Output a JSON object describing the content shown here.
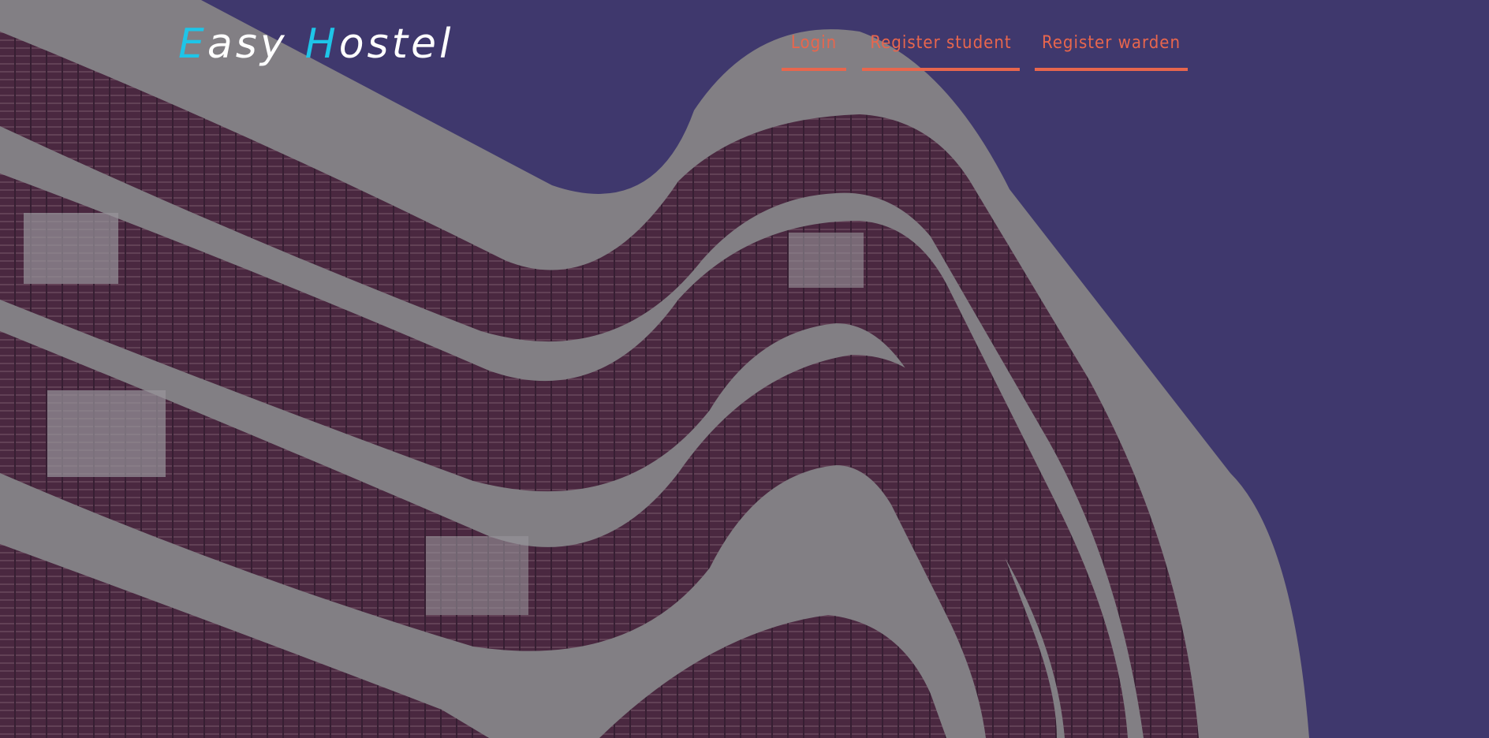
{
  "brand": {
    "initial_1": "E",
    "rest_1": "asy",
    "initial_2": "H",
    "rest_2": "ostel"
  },
  "nav": {
    "login": "Login",
    "register_student": "Register student",
    "register_warden": "Register warden"
  },
  "colors": {
    "sky": "#433c73",
    "facade": "#8f8c8e",
    "window_frame": "#3d2335",
    "accent": "#e8664d",
    "logo_accent": "#1ec5e8"
  },
  "background": {
    "image": "curved-building-icon"
  }
}
